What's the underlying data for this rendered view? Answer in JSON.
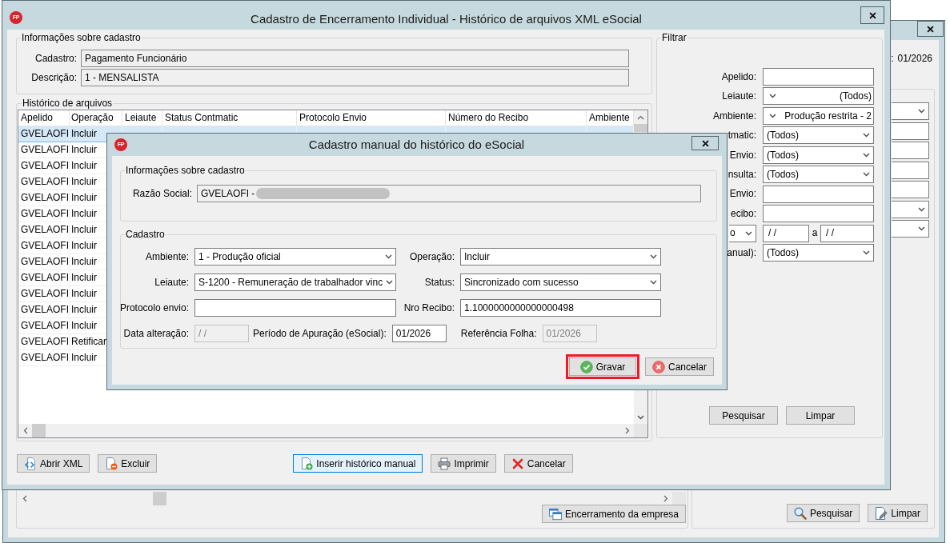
{
  "back_window": {
    "period": {
      "label": ":",
      "value": "01/2026"
    },
    "side_fields": [
      {
        "kind": "select"
      },
      {
        "kind": "input"
      },
      {
        "kind": "input"
      },
      {
        "kind": "input"
      },
      {
        "kind": "input"
      },
      {
        "kind": "select"
      },
      {
        "kind": "select"
      }
    ],
    "main_buttons": [
      {
        "kind": "company",
        "label": "Encerramento da empresa"
      }
    ],
    "side_buttons": [
      {
        "kind": "search",
        "label": "Pesquisar"
      },
      {
        "kind": "clear",
        "label": "Limpar"
      }
    ]
  },
  "main_window": {
    "logo": "FP",
    "title": "Cadastro de Encerramento Individual - Histórico de arquivos XML eSocial",
    "info_group": {
      "title": "Informações sobre cadastro",
      "fields": [
        {
          "label": "Cadastro:",
          "value": "Pagamento Funcionário"
        },
        {
          "label": "Descrição:",
          "value": "1 - MENSALISTA"
        }
      ]
    },
    "history_group": {
      "title": "Histórico de arquivos",
      "table": {
        "columns": [
          "Apelido",
          "Operação",
          "Leiaute",
          "Status Contmatic",
          "Protocolo Envio",
          "Número do Recibo",
          "Ambiente"
        ],
        "rows": [
          {
            "selected": true,
            "apelido": "GVELAOFI",
            "operacao": "Incluir"
          },
          {
            "selected": false,
            "apelido": "GVELAOFI",
            "operacao": "Incluir"
          },
          {
            "selected": false,
            "apelido": "GVELAOFI",
            "operacao": "Incluir"
          },
          {
            "selected": false,
            "apelido": "GVELAOFI",
            "operacao": "Incluir"
          },
          {
            "selected": false,
            "apelido": "GVELAOFI",
            "operacao": "Incluir"
          },
          {
            "selected": false,
            "apelido": "GVELAOFI",
            "operacao": "Incluir"
          },
          {
            "selected": false,
            "apelido": "GVELAOFI",
            "operacao": "Incluir"
          },
          {
            "selected": false,
            "apelido": "GVELAOFI",
            "operacao": "Incluir"
          },
          {
            "selected": false,
            "apelido": "GVELAOFI",
            "operacao": "Incluir"
          },
          {
            "selected": false,
            "apelido": "GVELAOFI",
            "operacao": "Incluir"
          },
          {
            "selected": false,
            "apelido": "GVELAOFI",
            "operacao": "Incluir"
          },
          {
            "selected": false,
            "apelido": "GVELAOFI",
            "operacao": "Incluir"
          },
          {
            "selected": false,
            "apelido": "GVELAOFI",
            "operacao": "Incluir"
          },
          {
            "selected": false,
            "apelido": "GVELAOFI",
            "operacao": "Retificar"
          },
          {
            "selected": false,
            "apelido": "GVELAOFI",
            "operacao": "Incluir"
          }
        ]
      }
    },
    "filter_group": {
      "title": "Filtrar",
      "fields": [
        {
          "kind": "input",
          "label": "Apelido:"
        },
        {
          "kind": "select",
          "label": "Leiaute:",
          "value": "(Todos)",
          "rtl": true
        },
        {
          "kind": "select",
          "label": "Ambiente:",
          "value": "Produção restrita - 2",
          "rtl": true
        },
        {
          "kind": "select",
          "label": "tmatic:",
          "value": "(Todos)",
          "rtl": false
        },
        {
          "kind": "select",
          "label": "Envio:",
          "value": "(Todos)",
          "rtl": false
        },
        {
          "kind": "select",
          "label": "nsulta:",
          "value": "(Todos)",
          "rtl": false
        },
        {
          "kind": "input",
          "label": "Envio:"
        },
        {
          "kind": "input",
          "label": "ecibo:"
        },
        {
          "kind": "range",
          "selector": "o",
          "from": "/ /",
          "separator": "a",
          "to": "/ /"
        },
        {
          "kind": "select",
          "label": "anual):",
          "value": "(Todos)",
          "rtl": false
        }
      ],
      "buttons": [
        {
          "label": "Pesquisar"
        },
        {
          "label": "Limpar"
        }
      ]
    },
    "buttons": [
      {
        "kind": "open",
        "label": "Abrir XML",
        "focused": false
      },
      {
        "kind": "delete",
        "label": "Excluir",
        "focused": false
      },
      {
        "kind": "insert",
        "label": "Inserir histórico manual",
        "focused": true
      },
      {
        "kind": "print",
        "label": "Imprimir",
        "focused": false
      },
      {
        "kind": "cancel",
        "label": "Cancelar",
        "focused": false
      }
    ]
  },
  "modal": {
    "logo": "FP",
    "title": "Cadastro manual do histórico do eSocial",
    "info_group": {
      "title": "Informações sobre cadastro",
      "label": "Razão Social:",
      "value": "GVELAOFI -",
      "redacted": true
    },
    "cadastro_group": {
      "title": "Cadastro",
      "rows": [
        [
          {
            "kind": "select",
            "label": "Ambiente:",
            "value": "1 - Produção oficial",
            "disabled": false
          },
          {
            "kind": "select",
            "label": "Operação:",
            "value": "Incluir",
            "disabled": false
          }
        ],
        [
          {
            "kind": "select",
            "label": "Leiaute:",
            "value": "S-1200 - Remuneração de trabalhador vinc",
            "disabled": false
          },
          {
            "kind": "select",
            "label": "Status:",
            "value": "Sincronizado com sucesso",
            "disabled": false
          }
        ],
        [
          {
            "kind": "input",
            "label": "Protocolo envio:",
            "disabled": false
          },
          {
            "kind": "input",
            "label": "Nro Recibo:",
            "value": "1.1000000000000000498",
            "disabled": false
          }
        ],
        [
          {
            "kind": "input",
            "label": "Data alteração:",
            "value": "/ /",
            "disabled": true
          },
          {
            "kind": "input",
            "label": "Período de Apuração (eSocial):",
            "value": "01/2026",
            "disabled": false
          },
          {
            "kind": "input",
            "label": "Referência Folha:",
            "value": "01/2026",
            "disabled": true
          }
        ]
      ]
    },
    "buttons": [
      {
        "kind": "save",
        "label": "Gravar",
        "highlighted": true
      },
      {
        "kind": "cancel",
        "label": "Cancelar",
        "highlighted": false
      }
    ]
  }
}
